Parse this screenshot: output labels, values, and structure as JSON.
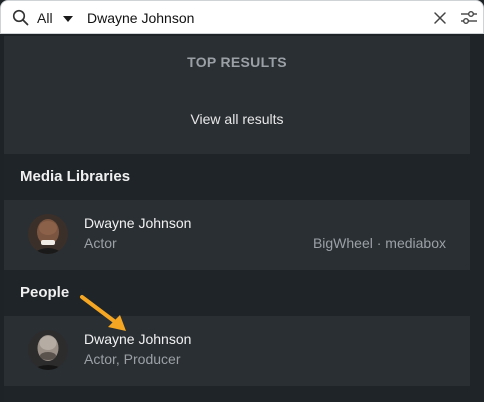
{
  "search": {
    "scope_label": "All",
    "query": "Dwayne Johnson"
  },
  "dropdown": {
    "top_results_label": "TOP RESULTS",
    "view_all_label": "View all results",
    "sections": [
      {
        "title": "Media Libraries",
        "results": [
          {
            "name": "Dwayne Johnson",
            "role": "Actor",
            "source": "BigWheel · mediabox"
          }
        ]
      },
      {
        "title": "People",
        "results": [
          {
            "name": "Dwayne Johnson",
            "role": "Actor, Producer"
          }
        ]
      }
    ]
  },
  "colors": {
    "panel_bg": "#2a2f33",
    "section_bg": "#1f2428",
    "accent_arrow": "#f5a623"
  }
}
